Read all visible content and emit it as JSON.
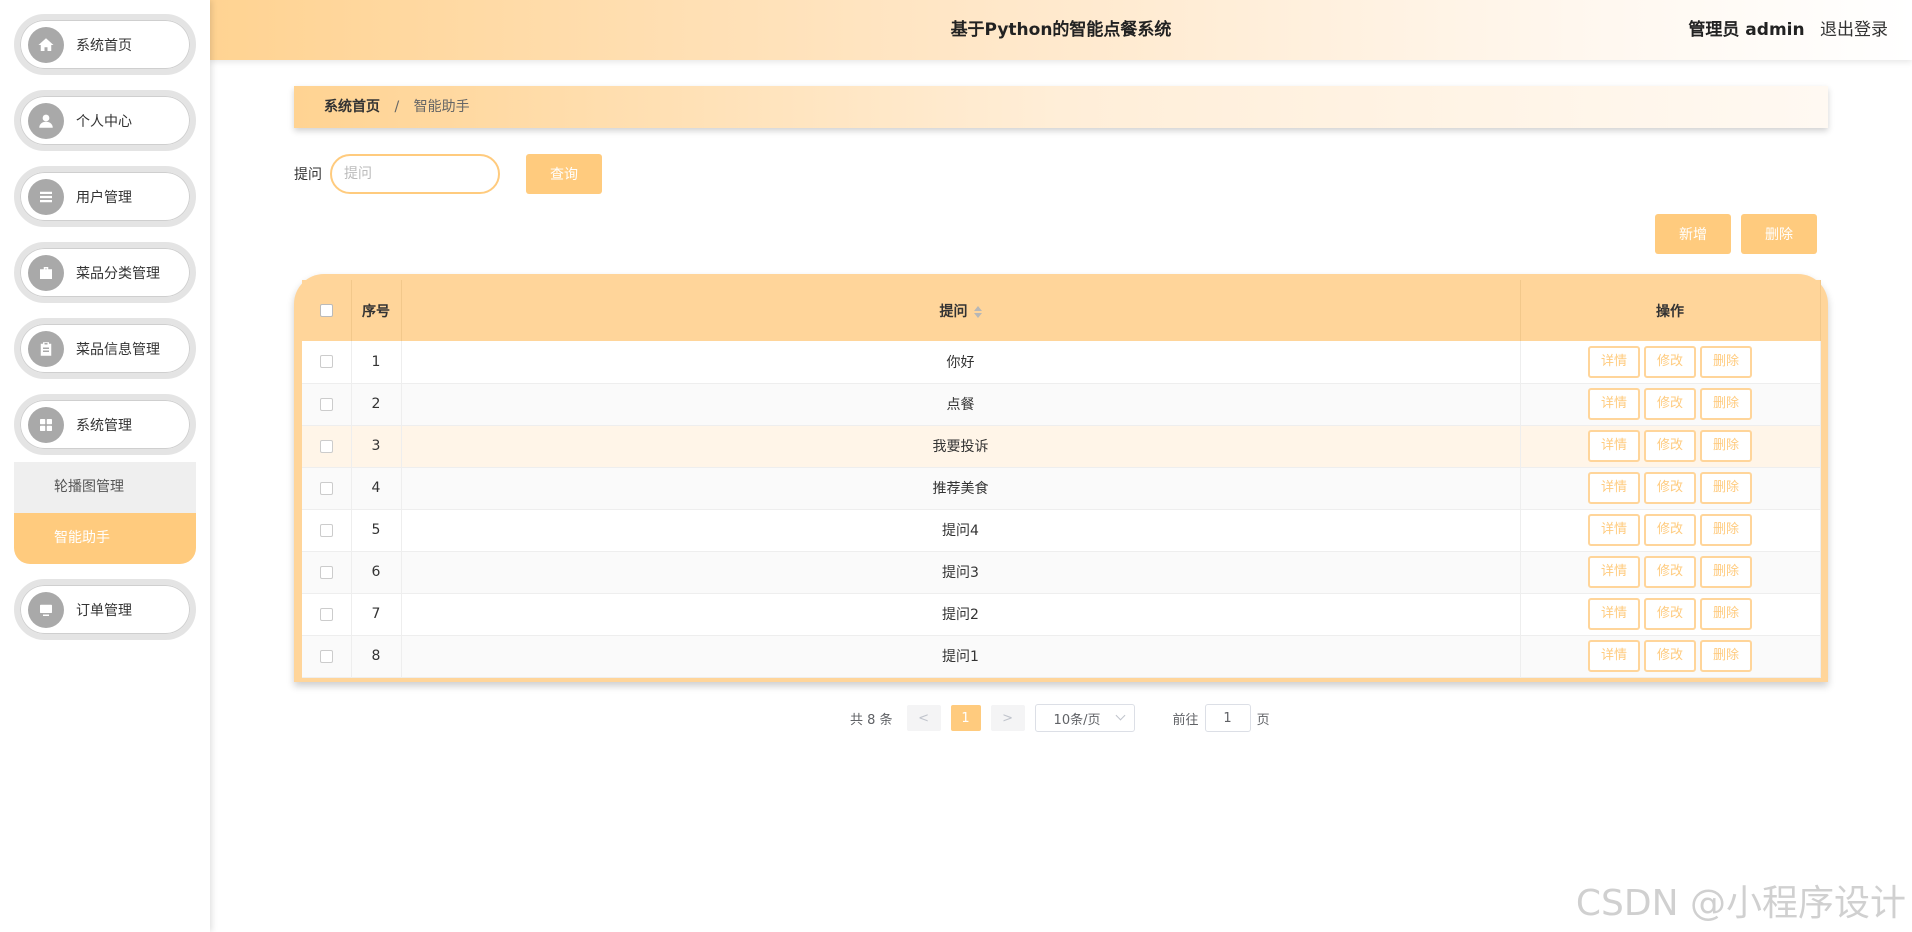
{
  "app": {
    "title": "基于Python的智能点餐系统",
    "user": "管理员 admin",
    "logout": "退出登录"
  },
  "sidebar": {
    "items": [
      {
        "label": "系统首页",
        "icon": "home-icon"
      },
      {
        "label": "个人中心",
        "icon": "user-icon"
      },
      {
        "label": "用户管理",
        "icon": "list-icon"
      },
      {
        "label": "菜品分类管理",
        "icon": "briefcase-icon"
      },
      {
        "label": "菜品信息管理",
        "icon": "clipboard-icon"
      },
      {
        "label": "系统管理",
        "icon": "grid-icon"
      },
      {
        "label": "订单管理",
        "icon": "monitor-icon"
      }
    ],
    "submenu": [
      {
        "label": "轮播图管理",
        "active": false
      },
      {
        "label": "智能助手",
        "active": true
      }
    ]
  },
  "breadcrumb": {
    "home": "系统首页",
    "separator": "/",
    "current": "智能助手"
  },
  "search": {
    "label": "提问",
    "placeholder": "提问",
    "button": "查询"
  },
  "actions": {
    "add": "新增",
    "delete": "删除"
  },
  "table": {
    "headers": {
      "index": "序号",
      "question": "提问",
      "ops": "操作"
    },
    "ops": {
      "detail": "详情",
      "edit": "修改",
      "delete": "删除"
    },
    "rows": [
      {
        "index": "1",
        "question": "你好"
      },
      {
        "index": "2",
        "question": "点餐"
      },
      {
        "index": "3",
        "question": "我要投诉"
      },
      {
        "index": "4",
        "question": "推荐美食"
      },
      {
        "index": "5",
        "question": "提问4"
      },
      {
        "index": "6",
        "question": "提问3"
      },
      {
        "index": "7",
        "question": "提问2"
      },
      {
        "index": "8",
        "question": "提问1"
      }
    ]
  },
  "pager": {
    "total": "共 8 条",
    "prev": "<",
    "page": "1",
    "next": ">",
    "size": "10条/页",
    "goto_prefix": "前往",
    "goto_value": "1",
    "goto_suffix": "页"
  },
  "watermark": "CSDN @小程序设计",
  "colors": {
    "accent": "#ffcb7e",
    "header_bg": "#ffd59a"
  }
}
